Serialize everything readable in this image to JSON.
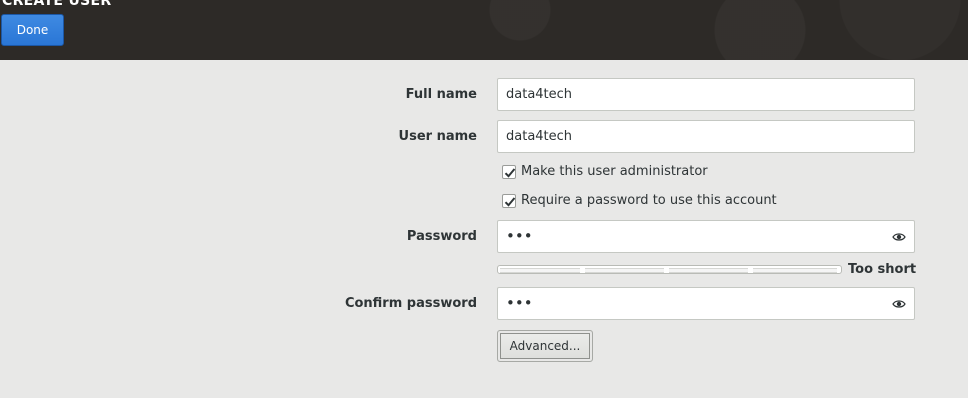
{
  "header": {
    "title": "CREATE USER",
    "done_label": "Done"
  },
  "form": {
    "full_name": {
      "label": "Full name",
      "value": "data4tech"
    },
    "user_name": {
      "label": "User name",
      "value": "data4tech"
    },
    "admin_checkbox": {
      "label": "Make this user administrator",
      "checked": true
    },
    "require_password_checkbox": {
      "label": "Require a password to use this account",
      "checked": true
    },
    "password": {
      "label": "Password",
      "masked_value": "•••",
      "icon": "eye-icon"
    },
    "strength": {
      "text": "Too short",
      "level": 0
    },
    "confirm_password": {
      "label": "Confirm password",
      "masked_value": "•••",
      "icon": "eye-icon"
    },
    "advanced_label": "Advanced..."
  },
  "colors": {
    "header_bg": "#2d2a27",
    "accent": "#2a76d6",
    "page_bg": "#e8e8e7"
  }
}
